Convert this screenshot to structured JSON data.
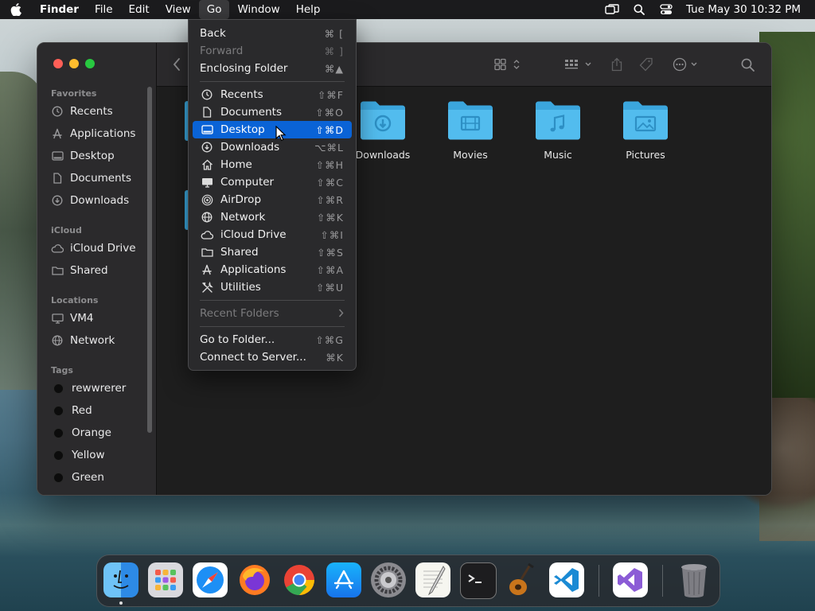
{
  "menubar": {
    "items": [
      "Finder",
      "File",
      "Edit",
      "View",
      "Go",
      "Window",
      "Help"
    ],
    "clock": "Tue May 30  10:32 PM"
  },
  "sidebar": {
    "favorites_label": "Favorites",
    "favorites": [
      "Recents",
      "Applications",
      "Desktop",
      "Documents",
      "Downloads"
    ],
    "icloud_label": "iCloud",
    "icloud": [
      "iCloud Drive",
      "Shared"
    ],
    "locations_label": "Locations",
    "locations": [
      "VM4",
      "Network"
    ],
    "tags_label": "Tags",
    "tags": [
      "rewwrerer",
      "Red",
      "Orange",
      "Yellow",
      "Green"
    ]
  },
  "folders": [
    "Downloads",
    "Movies",
    "Music",
    "Pictures"
  ],
  "go_menu": {
    "back": {
      "label": "Back",
      "shortcut": "⌘ ["
    },
    "forward": {
      "label": "Forward",
      "shortcut": "⌘ ]"
    },
    "enclosing": {
      "label": "Enclosing Folder",
      "shortcut": "⌘▲"
    },
    "places": [
      {
        "label": "Recents",
        "shortcut": "⇧⌘F",
        "icon": "clock-icon"
      },
      {
        "label": "Documents",
        "shortcut": "⇧⌘O",
        "icon": "document-icon"
      },
      {
        "label": "Desktop",
        "shortcut": "⇧⌘D",
        "icon": "desktop-icon"
      },
      {
        "label": "Downloads",
        "shortcut": "⌥⌘L",
        "icon": "download-icon"
      },
      {
        "label": "Home",
        "shortcut": "⇧⌘H",
        "icon": "home-icon"
      },
      {
        "label": "Computer",
        "shortcut": "⇧⌘C",
        "icon": "computer-icon"
      },
      {
        "label": "AirDrop",
        "shortcut": "⇧⌘R",
        "icon": "airdrop-icon"
      },
      {
        "label": "Network",
        "shortcut": "⇧⌘K",
        "icon": "network-icon"
      },
      {
        "label": "iCloud Drive",
        "shortcut": "⇧⌘I",
        "icon": "cloud-icon"
      },
      {
        "label": "Shared",
        "shortcut": "⇧⌘S",
        "icon": "shared-folder-icon"
      },
      {
        "label": "Applications",
        "shortcut": "⇧⌘A",
        "icon": "applications-icon"
      },
      {
        "label": "Utilities",
        "shortcut": "⇧⌘U",
        "icon": "utilities-icon"
      }
    ],
    "recent_folders": "Recent Folders",
    "goto": {
      "label": "Go to Folder...",
      "shortcut": "⇧⌘G"
    },
    "connect": {
      "label": "Connect to Server...",
      "shortcut": "⌘K"
    }
  },
  "colors": {
    "highlight": "#0a63d6",
    "folder": "#3aa9e0"
  },
  "dock": [
    "finder-icon",
    "launchpad-icon",
    "safari-icon",
    "firefox-icon",
    "chrome-icon",
    "app-store-icon",
    "system-settings-icon",
    "textedit-icon",
    "terminal-icon",
    "garageband-icon",
    "vscode-icon",
    "visual-studio-icon",
    "trash-icon"
  ]
}
